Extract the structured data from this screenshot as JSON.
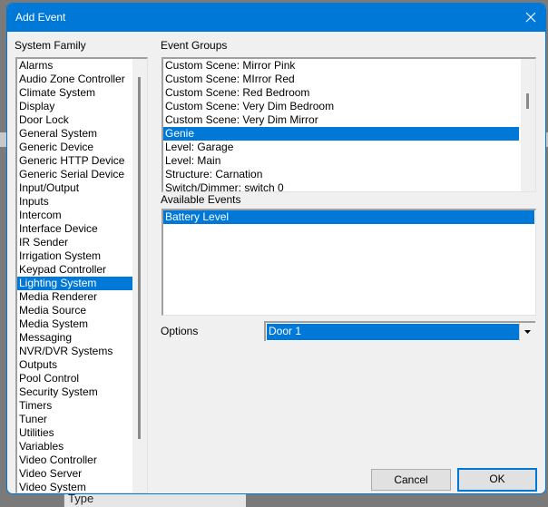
{
  "window": {
    "title": "Add Event",
    "close_icon": "close-icon"
  },
  "system_family": {
    "label": "System Family",
    "items": [
      "Alarms",
      "Audio Zone Controller",
      "Climate System",
      "Display",
      "Door Lock",
      "General System",
      "Generic Device",
      "Generic HTTP Device",
      "Generic Serial Device",
      "Input/Output",
      "Inputs",
      "Intercom",
      "Interface Device",
      "IR Sender",
      "Irrigation System",
      "Keypad Controller",
      "Lighting System",
      "Media Renderer",
      "Media Source",
      "Media System",
      "Messaging",
      "NVR/DVR Systems",
      "Outputs",
      "Pool Control",
      "Security System",
      "Timers",
      "Tuner",
      "Utilities",
      "Variables",
      "Video Controller",
      "Video Server",
      "Video System"
    ],
    "selected": "Lighting System"
  },
  "event_groups": {
    "label": "Event Groups",
    "items": [
      "Custom Scene: Mirror Pink",
      "Custom Scene: MIrror Red",
      "Custom Scene: Red Bedroom",
      "Custom Scene: Very Dim Bedroom",
      "Custom Scene: Very Dim Mirror",
      "Genie",
      "Level: Garage",
      "Level: Main",
      "Structure: Carnation",
      "Switch/Dimmer:  switch  0"
    ],
    "selected": "Genie"
  },
  "available_events": {
    "label": "Available Events",
    "items": [
      "Battery Level"
    ],
    "selected": "Battery Level"
  },
  "options": {
    "label": "Options",
    "value": "Door 1"
  },
  "buttons": {
    "cancel": "Cancel",
    "ok": "OK"
  },
  "background": {
    "partial_label": "Type"
  },
  "colors": {
    "accent": "#0078d7",
    "dialog_bg": "#f0f0f0"
  }
}
